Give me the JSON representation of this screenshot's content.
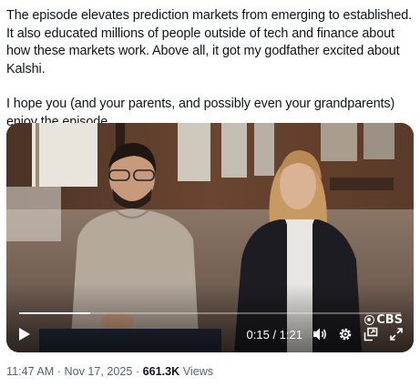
{
  "post": {
    "paragraph_1": "The episode elevates prediction markets from emerging to established. It also educated millions of people outside of tech and finance about how these markets work. Above all, it got my godfather excited about Kalshi.",
    "paragraph_2": "I hope you (and your parents, and possibly even your grandparents) enjoy the episode."
  },
  "video": {
    "time_display": "0:15 / 1:21",
    "progress_fraction": 0.185,
    "broadcaster_logo_text": "CBS",
    "icons": {
      "play": "play-icon",
      "volume": "volume-icon",
      "settings": "gear-icon",
      "pip": "picture-in-picture-icon",
      "fullscreen": "fullscreen-icon"
    }
  },
  "meta": {
    "time": "11:47 AM",
    "separator": "·",
    "date": "Nov 17, 2025",
    "views_count": "661.3K",
    "views_label": "Views"
  },
  "colors": {
    "text": "#0f1419",
    "secondary_text": "#536471",
    "controls": "#ffffff"
  }
}
